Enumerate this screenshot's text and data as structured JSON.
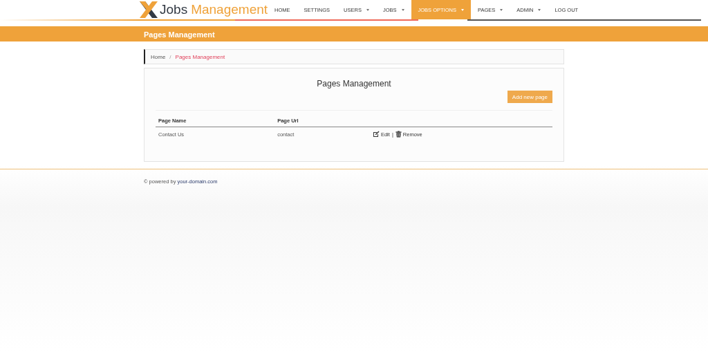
{
  "header": {
    "logo": {
      "text_dark": "Jobs",
      "text_accent": "Management"
    },
    "nav": [
      {
        "label": "HOME",
        "dropdown": false,
        "selected": false
      },
      {
        "label": "SETTINGS",
        "dropdown": false,
        "selected": false
      },
      {
        "label": "USERS",
        "dropdown": true,
        "selected": false
      },
      {
        "label": "JOBS",
        "dropdown": true,
        "selected": false
      },
      {
        "label": "JOBS OPTIONS",
        "dropdown": true,
        "selected": true
      },
      {
        "label": "PAGES",
        "dropdown": true,
        "selected": false
      },
      {
        "label": "ADMIN",
        "dropdown": true,
        "selected": false
      },
      {
        "label": "LOG OUT",
        "dropdown": false,
        "selected": false
      }
    ]
  },
  "page_title": "Pages Management",
  "breadcrumb_separator": "/",
  "breadcrumb": [
    {
      "label": "Home",
      "selected": false
    },
    {
      "label": "Pages Management",
      "selected": true
    }
  ],
  "card": {
    "title": "Pages Management",
    "add_button": "Add new page",
    "table": {
      "columns": [
        "Page Name",
        "Page Url"
      ],
      "rows": [
        {
          "name": "Contact Us",
          "url": "contact",
          "actions": [
            {
              "kind": "edit",
              "label": "Edit"
            },
            {
              "kind": "remove",
              "label": "Remove"
            }
          ],
          "separator": "|"
        }
      ]
    }
  },
  "footer": {
    "prefix": "© powered by",
    "link": "your-domain.com"
  }
}
